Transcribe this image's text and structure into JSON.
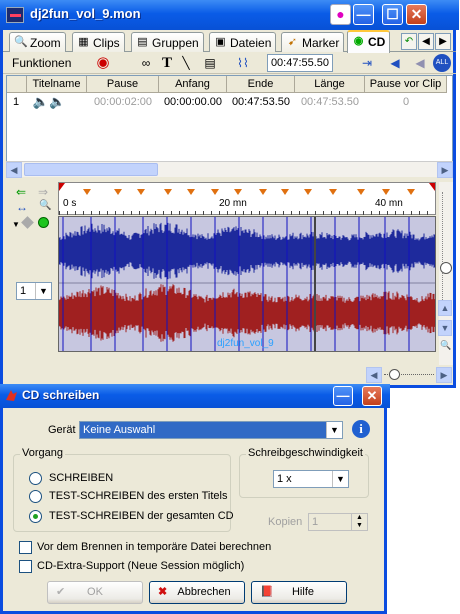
{
  "main_window": {
    "title": "dj2fun_vol_9.mon",
    "tabs": [
      {
        "label": "Zoom",
        "icon": "magnifier-icon"
      },
      {
        "label": "Clips",
        "icon": "clips-icon"
      },
      {
        "label": "Gruppen",
        "icon": "groups-icon"
      },
      {
        "label": "Dateien",
        "icon": "files-icon"
      },
      {
        "label": "Marker",
        "icon": "marker-icon"
      },
      {
        "label": "CD",
        "icon": "cd-icon"
      }
    ],
    "toolbar": {
      "functions_label": "Funktionen",
      "time_display": "00:47:55.50"
    },
    "track_table": {
      "columns": [
        "Titelname",
        "Pause",
        "Anfang",
        "Ende",
        "Länge",
        "Pause vor Clip"
      ],
      "rows": [
        {
          "index": "1",
          "title": "",
          "pause": "00:00:02:00",
          "start": "00:00:00.00",
          "end": "00:47:53.50",
          "length": "00:47:53.50",
          "pause_before": "0"
        }
      ]
    },
    "ruler": {
      "labels": [
        "0 s",
        "20 mn",
        "40 mn"
      ]
    },
    "track_selector": "1",
    "waveform_label": "dj2fun_vol_9",
    "colors": {
      "left_channel": "#1e2a9c",
      "right_channel": "#a02020",
      "waveform_bg": "#c7c7e0",
      "marker": "#e07010"
    }
  },
  "dialog": {
    "title": "CD schreiben",
    "device_label": "Gerät",
    "device_value": "Keine Auswahl",
    "mode_group": {
      "legend": "Vorgang",
      "options": [
        "SCHREIBEN",
        "TEST-SCHREIBEN des ersten Titels",
        "TEST-SCHREIBEN der gesamten CD"
      ],
      "selected_index": 2
    },
    "speed_group": {
      "legend": "Schreibgeschwindigkeit",
      "value": "1 x"
    },
    "copies_label": "Kopien",
    "copies_value": "1",
    "checkboxes": [
      {
        "label": "Vor dem Brennen in temporäre Datei berechnen",
        "checked": false
      },
      {
        "label": "CD-Extra-Support (Neue Session möglich)",
        "checked": false
      }
    ],
    "buttons": {
      "ok": "OK",
      "cancel": "Abbrechen",
      "help": "Hilfe"
    }
  }
}
